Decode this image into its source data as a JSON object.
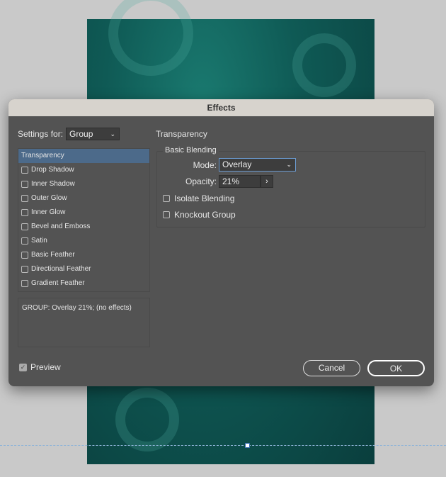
{
  "dialog": {
    "title": "Effects"
  },
  "settings_for": {
    "label": "Settings for:",
    "value": "Group"
  },
  "effects_list": [
    {
      "label": "Transparency",
      "active": true
    },
    {
      "label": "Drop Shadow",
      "checked": false
    },
    {
      "label": "Inner Shadow",
      "checked": false
    },
    {
      "label": "Outer Glow",
      "checked": false
    },
    {
      "label": "Inner Glow",
      "checked": false
    },
    {
      "label": "Bevel and Emboss",
      "checked": false
    },
    {
      "label": "Satin",
      "checked": false
    },
    {
      "label": "Basic Feather",
      "checked": false
    },
    {
      "label": "Directional Feather",
      "checked": false
    },
    {
      "label": "Gradient Feather",
      "checked": false
    }
  ],
  "description": "GROUP: Overlay 21%; (no effects)",
  "panel": {
    "title": "Transparency",
    "section": "Basic Blending",
    "mode_label": "Mode:",
    "mode_value": "Overlay",
    "opacity_label": "Opacity:",
    "opacity_value": "21%",
    "isolate_label": "Isolate Blending",
    "knockout_label": "Knockout Group"
  },
  "preview": {
    "label": "Preview",
    "checked": true
  },
  "buttons": {
    "cancel": "Cancel",
    "ok": "OK"
  },
  "colors": {
    "accent": "#4c6a8a",
    "dialog_bg": "#535353",
    "artwork": "#0f5a55"
  }
}
